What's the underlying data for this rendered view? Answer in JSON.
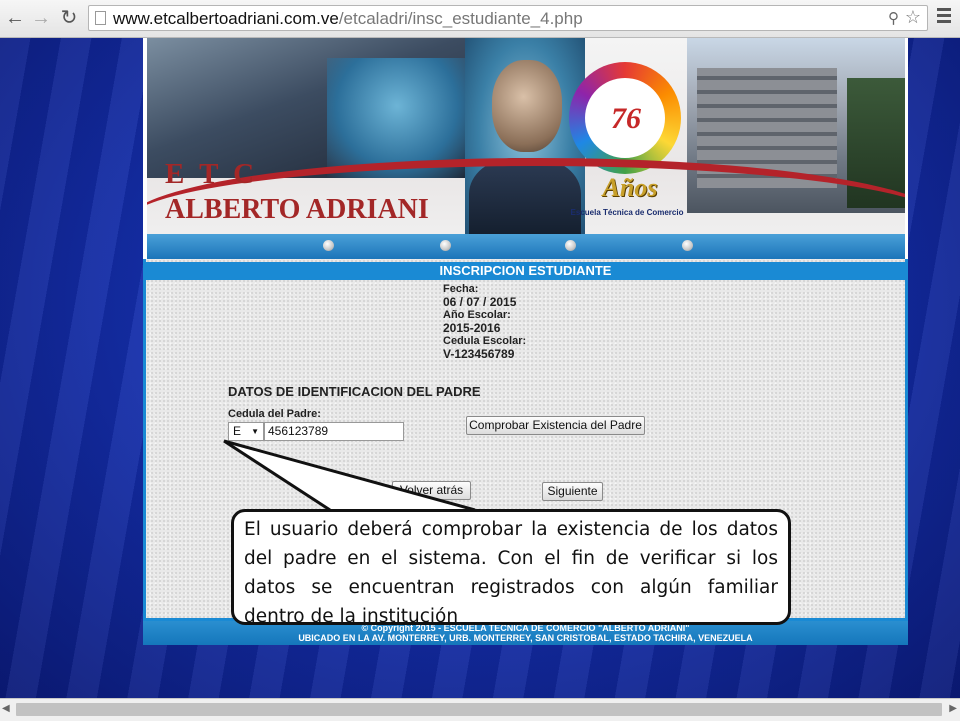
{
  "browser": {
    "url_host": "www.etcalbertoadriani.com.ve",
    "url_path": "/etcaladri/insc_estudiante_4.php",
    "back_icon": "arrow-left-icon",
    "forward_icon": "arrow-right-icon",
    "reload_icon": "reload-icon",
    "star_icon": "star-icon",
    "menu_icon": "hamburger-menu-icon"
  },
  "banner": {
    "title_line1": "E T C",
    "title_line2": "ALBERTO ADRIANI",
    "logo_number": "76",
    "logo_years": "Años",
    "logo_caption": "Escuela Técnica de Comercio"
  },
  "form": {
    "header": "INSCRIPCION ESTUDIANTE",
    "fecha_label": "Fecha:",
    "fecha_value": "06 / 07 / 2015",
    "anio_label": "Año Escolar:",
    "anio_value": "2015-2016",
    "cedula_escolar_label": "Cedula Escolar:",
    "cedula_escolar_value": "V-123456789",
    "section_title": "DATOS DE IDENTIFICACION DEL PADRE",
    "cedula_padre_label": "Cedula del Padre:",
    "nacionalidad_selected": "E",
    "cedula_padre_value": "456123789",
    "check_button": "Comprobar Existencia del Padre",
    "back_button": "Volver atrás",
    "next_button": "Siguiente"
  },
  "footer": {
    "line1": "© Copyright 2015 - ESCUELA TECNICA DE COMERCIO \"ALBERTO ADRIANI\"",
    "line2": "UBICADO EN LA AV. MONTERREY, URB. MONTERREY, SAN CRISTOBAL, ESTADO TACHIRA, VENEZUELA"
  },
  "callout": {
    "text": "El usuario deberá comprobar la existencia de los datos del padre en el sistema. Con el fin de verificar si los datos se encuentran registrados con algún familiar dentro de la institución"
  },
  "colors": {
    "accent_blue": "#1a8ad4",
    "title_red": "#a32727",
    "page_background": "#1530b0"
  }
}
